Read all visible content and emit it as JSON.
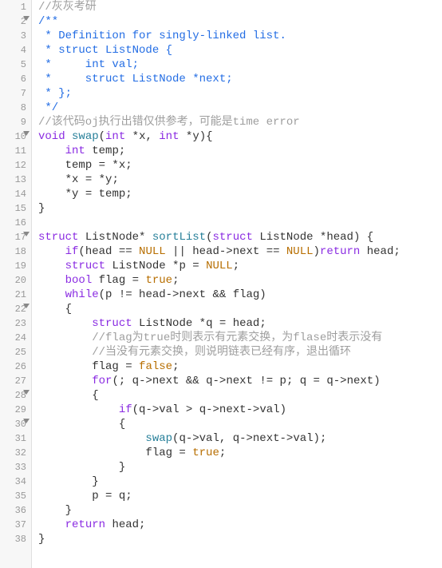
{
  "editor": {
    "fold_lines": [
      2,
      10,
      17,
      22,
      28,
      30
    ],
    "lines": [
      {
        "n": 1,
        "tokens": [
          [
            "comment",
            "//灰灰考研"
          ]
        ]
      },
      {
        "n": 2,
        "tokens": [
          [
            "doc",
            "/**"
          ]
        ]
      },
      {
        "n": 3,
        "tokens": [
          [
            "doc",
            " * Definition for singly-linked list."
          ]
        ]
      },
      {
        "n": 4,
        "tokens": [
          [
            "doc",
            " * struct ListNode {"
          ]
        ]
      },
      {
        "n": 5,
        "tokens": [
          [
            "doc",
            " *     int val;"
          ]
        ]
      },
      {
        "n": 6,
        "tokens": [
          [
            "doc",
            " *     struct ListNode *next;"
          ]
        ]
      },
      {
        "n": 7,
        "tokens": [
          [
            "doc",
            " * };"
          ]
        ]
      },
      {
        "n": 8,
        "tokens": [
          [
            "doc",
            " */"
          ]
        ]
      },
      {
        "n": 9,
        "tokens": [
          [
            "comment",
            "//该代码oj执行出错仅供参考，可能是time error"
          ]
        ]
      },
      {
        "n": 10,
        "tokens": [
          [
            "type",
            "void"
          ],
          [
            "plain",
            " "
          ],
          [
            "func",
            "swap"
          ],
          [
            "plain",
            "("
          ],
          [
            "type",
            "int"
          ],
          [
            "plain",
            " *"
          ],
          [
            "ident",
            "x"
          ],
          [
            "plain",
            ", "
          ],
          [
            "type",
            "int"
          ],
          [
            "plain",
            " *"
          ],
          [
            "ident",
            "y"
          ],
          [
            "plain",
            "){"
          ]
        ]
      },
      {
        "n": 11,
        "tokens": [
          [
            "plain",
            "    "
          ],
          [
            "type",
            "int"
          ],
          [
            "plain",
            " "
          ],
          [
            "ident",
            "temp"
          ],
          [
            "plain",
            ";"
          ]
        ]
      },
      {
        "n": 12,
        "tokens": [
          [
            "plain",
            "    "
          ],
          [
            "ident",
            "temp"
          ],
          [
            "plain",
            " = *"
          ],
          [
            "ident",
            "x"
          ],
          [
            "plain",
            ";"
          ]
        ]
      },
      {
        "n": 13,
        "tokens": [
          [
            "plain",
            "    *"
          ],
          [
            "ident",
            "x"
          ],
          [
            "plain",
            " = *"
          ],
          [
            "ident",
            "y"
          ],
          [
            "plain",
            ";"
          ]
        ]
      },
      {
        "n": 14,
        "tokens": [
          [
            "plain",
            "    *"
          ],
          [
            "ident",
            "y"
          ],
          [
            "plain",
            " = "
          ],
          [
            "ident",
            "temp"
          ],
          [
            "plain",
            ";"
          ]
        ]
      },
      {
        "n": 15,
        "tokens": [
          [
            "plain",
            "}"
          ]
        ]
      },
      {
        "n": 16,
        "tokens": [
          [
            "plain",
            ""
          ]
        ]
      },
      {
        "n": 17,
        "tokens": [
          [
            "type",
            "struct"
          ],
          [
            "plain",
            " "
          ],
          [
            "ident",
            "ListNode"
          ],
          [
            "plain",
            "* "
          ],
          [
            "func",
            "sortList"
          ],
          [
            "plain",
            "("
          ],
          [
            "type",
            "struct"
          ],
          [
            "plain",
            " "
          ],
          [
            "ident",
            "ListNode"
          ],
          [
            "plain",
            " *"
          ],
          [
            "ident",
            "head"
          ],
          [
            "plain",
            ") {"
          ]
        ]
      },
      {
        "n": 18,
        "tokens": [
          [
            "plain",
            "    "
          ],
          [
            "keyword",
            "if"
          ],
          [
            "plain",
            "("
          ],
          [
            "ident",
            "head"
          ],
          [
            "plain",
            " == "
          ],
          [
            "const",
            "NULL"
          ],
          [
            "plain",
            " || "
          ],
          [
            "ident",
            "head"
          ],
          [
            "plain",
            "->"
          ],
          [
            "ident",
            "next"
          ],
          [
            "plain",
            " == "
          ],
          [
            "const",
            "NULL"
          ],
          [
            "plain",
            ")"
          ],
          [
            "keyword",
            "return"
          ],
          [
            "plain",
            " "
          ],
          [
            "ident",
            "head"
          ],
          [
            "plain",
            ";"
          ]
        ]
      },
      {
        "n": 19,
        "tokens": [
          [
            "plain",
            "    "
          ],
          [
            "type",
            "struct"
          ],
          [
            "plain",
            " "
          ],
          [
            "ident",
            "ListNode"
          ],
          [
            "plain",
            " *"
          ],
          [
            "ident",
            "p"
          ],
          [
            "plain",
            " = "
          ],
          [
            "const",
            "NULL"
          ],
          [
            "plain",
            ";"
          ]
        ]
      },
      {
        "n": 20,
        "tokens": [
          [
            "plain",
            "    "
          ],
          [
            "type",
            "bool"
          ],
          [
            "plain",
            " "
          ],
          [
            "ident",
            "flag"
          ],
          [
            "plain",
            " = "
          ],
          [
            "const",
            "true"
          ],
          [
            "plain",
            ";"
          ]
        ]
      },
      {
        "n": 21,
        "tokens": [
          [
            "plain",
            "    "
          ],
          [
            "keyword",
            "while"
          ],
          [
            "plain",
            "("
          ],
          [
            "ident",
            "p"
          ],
          [
            "plain",
            " != "
          ],
          [
            "ident",
            "head"
          ],
          [
            "plain",
            "->"
          ],
          [
            "ident",
            "next"
          ],
          [
            "plain",
            " && "
          ],
          [
            "ident",
            "flag"
          ],
          [
            "plain",
            ")"
          ]
        ]
      },
      {
        "n": 22,
        "tokens": [
          [
            "plain",
            "    {"
          ]
        ]
      },
      {
        "n": 23,
        "tokens": [
          [
            "plain",
            "        "
          ],
          [
            "type",
            "struct"
          ],
          [
            "plain",
            " "
          ],
          [
            "ident",
            "ListNode"
          ],
          [
            "plain",
            " *"
          ],
          [
            "ident",
            "q"
          ],
          [
            "plain",
            " = "
          ],
          [
            "ident",
            "head"
          ],
          [
            "plain",
            ";"
          ]
        ]
      },
      {
        "n": 24,
        "tokens": [
          [
            "plain",
            "        "
          ],
          [
            "comment",
            "//flag为true时则表示有元素交换，为flase时表示没有"
          ]
        ]
      },
      {
        "n": 25,
        "tokens": [
          [
            "plain",
            "        "
          ],
          [
            "comment",
            "//当没有元素交换，则说明链表已经有序，退出循环"
          ]
        ]
      },
      {
        "n": 26,
        "tokens": [
          [
            "plain",
            "        "
          ],
          [
            "ident",
            "flag"
          ],
          [
            "plain",
            " = "
          ],
          [
            "const",
            "false"
          ],
          [
            "plain",
            ";"
          ]
        ]
      },
      {
        "n": 27,
        "tokens": [
          [
            "plain",
            "        "
          ],
          [
            "keyword",
            "for"
          ],
          [
            "plain",
            "(; "
          ],
          [
            "ident",
            "q"
          ],
          [
            "plain",
            "->"
          ],
          [
            "ident",
            "next"
          ],
          [
            "plain",
            " && "
          ],
          [
            "ident",
            "q"
          ],
          [
            "plain",
            "->"
          ],
          [
            "ident",
            "next"
          ],
          [
            "plain",
            " != "
          ],
          [
            "ident",
            "p"
          ],
          [
            "plain",
            "; "
          ],
          [
            "ident",
            "q"
          ],
          [
            "plain",
            " = "
          ],
          [
            "ident",
            "q"
          ],
          [
            "plain",
            "->"
          ],
          [
            "ident",
            "next"
          ],
          [
            "plain",
            ")"
          ]
        ]
      },
      {
        "n": 28,
        "tokens": [
          [
            "plain",
            "        {"
          ]
        ]
      },
      {
        "n": 29,
        "tokens": [
          [
            "plain",
            "            "
          ],
          [
            "keyword",
            "if"
          ],
          [
            "plain",
            "("
          ],
          [
            "ident",
            "q"
          ],
          [
            "plain",
            "->"
          ],
          [
            "ident",
            "val"
          ],
          [
            "plain",
            " > "
          ],
          [
            "ident",
            "q"
          ],
          [
            "plain",
            "->"
          ],
          [
            "ident",
            "next"
          ],
          [
            "plain",
            "->"
          ],
          [
            "ident",
            "val"
          ],
          [
            "plain",
            ")"
          ]
        ]
      },
      {
        "n": 30,
        "tokens": [
          [
            "plain",
            "            {"
          ]
        ]
      },
      {
        "n": 31,
        "tokens": [
          [
            "plain",
            "                "
          ],
          [
            "func",
            "swap"
          ],
          [
            "plain",
            "("
          ],
          [
            "ident",
            "q"
          ],
          [
            "plain",
            "->"
          ],
          [
            "ident",
            "val"
          ],
          [
            "plain",
            ", "
          ],
          [
            "ident",
            "q"
          ],
          [
            "plain",
            "->"
          ],
          [
            "ident",
            "next"
          ],
          [
            "plain",
            "->"
          ],
          [
            "ident",
            "val"
          ],
          [
            "plain",
            ");"
          ]
        ]
      },
      {
        "n": 32,
        "tokens": [
          [
            "plain",
            "                "
          ],
          [
            "ident",
            "flag"
          ],
          [
            "plain",
            " = "
          ],
          [
            "const",
            "true"
          ],
          [
            "plain",
            ";"
          ]
        ]
      },
      {
        "n": 33,
        "tokens": [
          [
            "plain",
            "            }"
          ]
        ]
      },
      {
        "n": 34,
        "tokens": [
          [
            "plain",
            "        }"
          ]
        ]
      },
      {
        "n": 35,
        "tokens": [
          [
            "plain",
            "        "
          ],
          [
            "ident",
            "p"
          ],
          [
            "plain",
            " = "
          ],
          [
            "ident",
            "q"
          ],
          [
            "plain",
            ";"
          ]
        ]
      },
      {
        "n": 36,
        "tokens": [
          [
            "plain",
            "    }"
          ]
        ]
      },
      {
        "n": 37,
        "tokens": [
          [
            "plain",
            "    "
          ],
          [
            "keyword",
            "return"
          ],
          [
            "plain",
            " "
          ],
          [
            "ident",
            "head"
          ],
          [
            "plain",
            ";"
          ]
        ]
      },
      {
        "n": 38,
        "tokens": [
          [
            "plain",
            "}"
          ]
        ]
      }
    ]
  }
}
